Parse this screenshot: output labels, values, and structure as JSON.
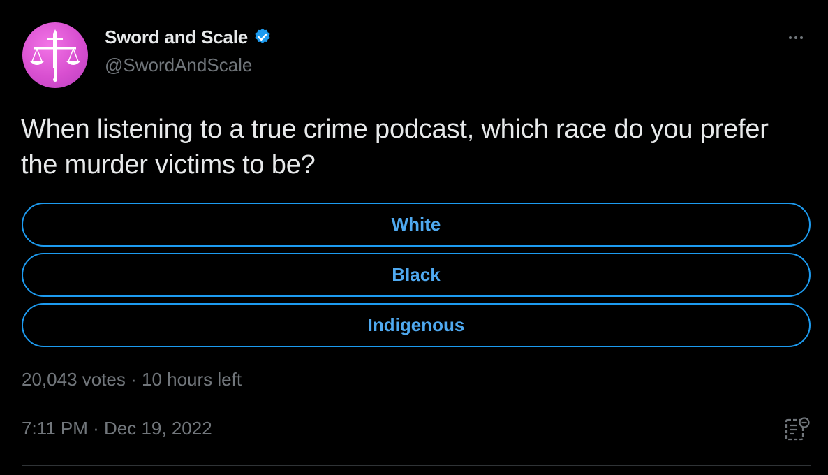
{
  "author": {
    "display_name": "Sword and Scale",
    "handle": "@SwordAndScale",
    "verified": true,
    "avatar_icon": "sword-scale-logo-icon"
  },
  "tweet": {
    "text": "When listening to a true crime podcast, which race do you prefer the murder victims to be?"
  },
  "poll": {
    "options": [
      {
        "label": "White"
      },
      {
        "label": "Black"
      },
      {
        "label": "Indigenous"
      }
    ],
    "votes": "20,043 votes",
    "separator": "·",
    "time_left": "10 hours left",
    "meta_text": "20,043 votes · 10 hours left"
  },
  "timestamp": "7:11 PM · Dec 19, 2022",
  "icons": {
    "more": "more-options-icon",
    "analytics": "analytics-icon",
    "verified": "verified-badge-icon"
  },
  "colors": {
    "background": "#000000",
    "text_primary": "#e7e9ea",
    "text_secondary": "#71767b",
    "accent": "#1d9bf0",
    "avatar": "#d84fd0"
  }
}
